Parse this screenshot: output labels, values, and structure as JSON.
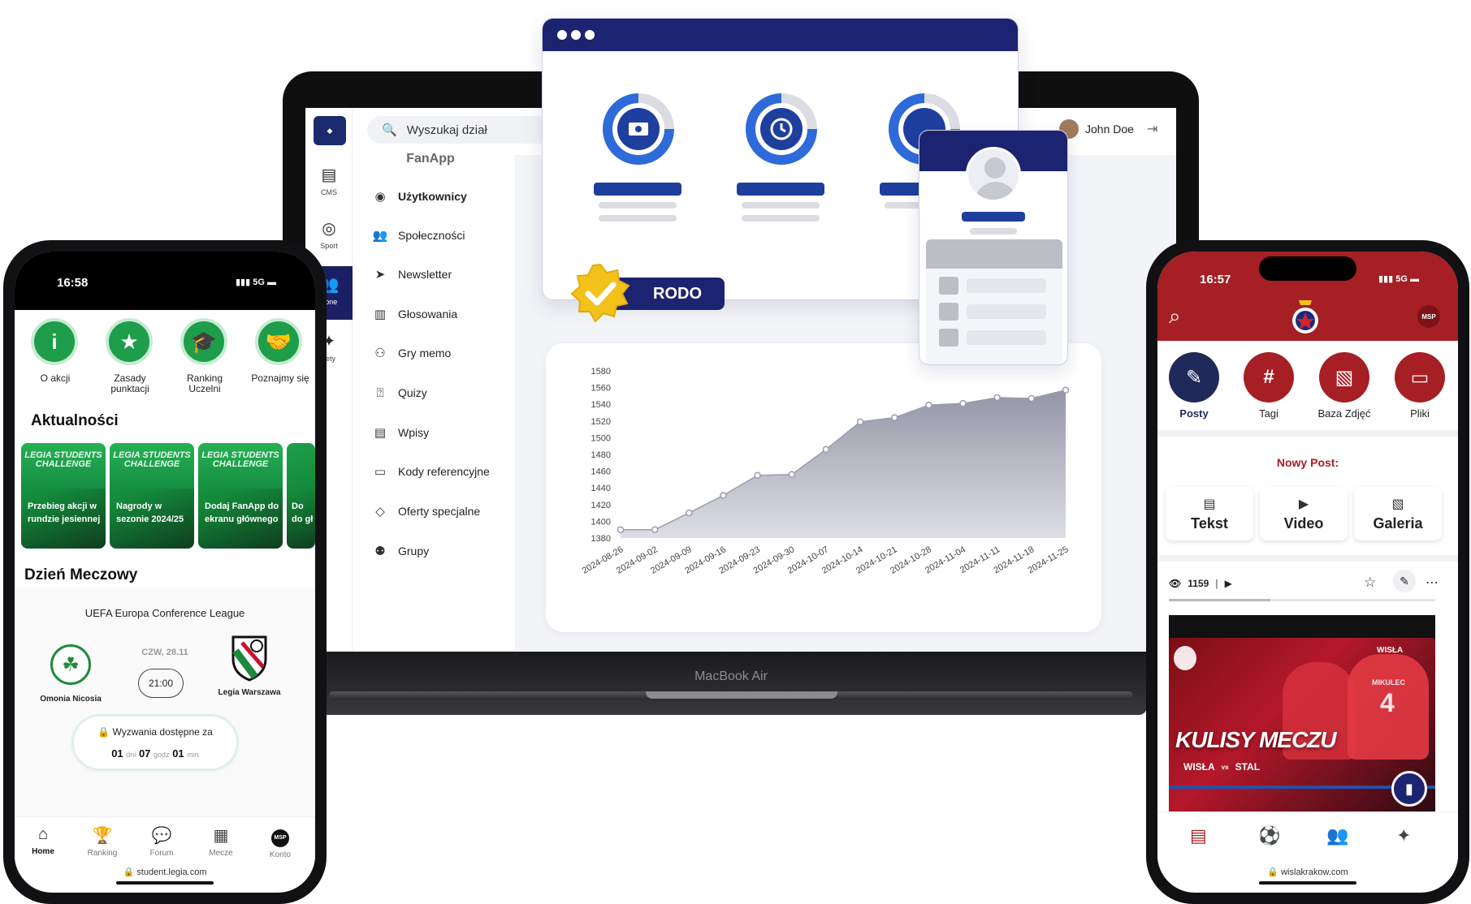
{
  "laptop": {
    "model_label": "MacBook Air",
    "search_placeholder": "Wyszukaj dział",
    "user_name": "John Doe",
    "rail": [
      {
        "label": "CMS",
        "icon": "document-icon"
      },
      {
        "label": "Sport",
        "icon": "basketball-icon"
      },
      {
        "label": "Zone",
        "icon": "users-icon"
      },
      {
        "label": "ilety",
        "icon": "ticket-icon"
      }
    ],
    "menu_title": "FanApp",
    "menu": [
      {
        "label": "Użytkownicy",
        "icon": "user-circle-icon",
        "active": true
      },
      {
        "label": "Społeczności",
        "icon": "group-icon"
      },
      {
        "label": "Newsletter",
        "icon": "send-icon"
      },
      {
        "label": "Głosowania",
        "icon": "poll-icon"
      },
      {
        "label": "Gry memo",
        "icon": "brain-icon"
      },
      {
        "label": "Quizy",
        "icon": "quiz-icon"
      },
      {
        "label": "Wpisy",
        "icon": "post-icon"
      },
      {
        "label": "Kody referencyjne",
        "icon": "code-icon"
      },
      {
        "label": "Oferty specjalne",
        "icon": "tag-icon"
      },
      {
        "label": "Grupy",
        "icon": "users-group-icon"
      }
    ]
  },
  "rodo_label": "RODO",
  "chart_data": {
    "type": "area",
    "x": [
      "2024-08-26",
      "2024-09-02",
      "2024-09-09",
      "2024-09-16",
      "2024-09-23",
      "2024-09-30",
      "2024-10-07",
      "2024-10-14",
      "2024-10-21",
      "2024-10-28",
      "2024-11-04",
      "2024-11-11",
      "2024-11-18",
      "2024-11-25"
    ],
    "values": [
      1390,
      1390,
      1410,
      1431,
      1455,
      1456,
      1486,
      1519,
      1524,
      1539,
      1541,
      1548,
      1547,
      1557
    ],
    "yticks": [
      1380,
      1400,
      1420,
      1440,
      1460,
      1480,
      1500,
      1520,
      1540,
      1560,
      1580
    ],
    "ylim": [
      1380,
      1580
    ],
    "grid": false,
    "colors": {
      "fill": "#8e8fa0",
      "line": "#9a9bb0"
    }
  },
  "legia": {
    "time": "16:58",
    "signal": "5G",
    "actions": [
      {
        "label": "O akcji",
        "icon": "info-icon"
      },
      {
        "label": "Zasady punktacji",
        "icon": "star-icon"
      },
      {
        "label": "Ranking Uczelni",
        "icon": "graduation-cap-icon"
      },
      {
        "label": "Poznajmy się",
        "icon": "handshake-icon"
      }
    ],
    "news_heading": "Aktualności",
    "news_card_brand": "LEGIA STUDENTS CHALLENGE",
    "news": [
      "Przebieg akcji w rundzie jesiennej",
      "Nagrody w sezonie 2024/25",
      "Dodaj FanApp do ekranu głównego",
      "Do do gł"
    ],
    "match_heading": "Dzień Meczowy",
    "league": "UEFA Europa Conference League",
    "home_team": "Omonia Nicosia",
    "away_team": "Legia Warszawa",
    "match_date": "CZW, 28.11",
    "match_time": "21:00",
    "countdown_label": "Wyzwania dostępne za",
    "countdown": {
      "d": "01",
      "d_unit": "dni",
      "h": "07",
      "h_unit": "godz",
      "m": "01",
      "m_unit": "min"
    },
    "nav": [
      {
        "label": "Home",
        "icon": "home-icon",
        "active": true
      },
      {
        "label": "Ranking",
        "icon": "trophy-icon"
      },
      {
        "label": "Forum",
        "icon": "chat-icon"
      },
      {
        "label": "Mecze",
        "icon": "calendar-icon"
      },
      {
        "label": "Konto",
        "icon": "account-icon",
        "badge": "MSP"
      }
    ],
    "url": "student.legia.com"
  },
  "wisla": {
    "time": "16:57",
    "signal": "5G",
    "avatar_badge": "MSP",
    "actions": [
      {
        "label": "Posty",
        "icon": "post-add-icon",
        "color": "#1f2a5a",
        "active": true
      },
      {
        "label": "Tagi",
        "icon": "hashtag-icon",
        "color": "#a51f24"
      },
      {
        "label": "Baza Zdjęć",
        "icon": "image-icon",
        "color": "#a51f24"
      },
      {
        "label": "Pliki",
        "icon": "folder-icon",
        "color": "#a51f24"
      }
    ],
    "new_post_label": "Nowy Post:",
    "post_types": [
      {
        "label": "Tekst",
        "icon": "text-icon"
      },
      {
        "label": "Video",
        "icon": "video-icon"
      },
      {
        "label": "Galeria",
        "icon": "gallery-icon"
      }
    ],
    "views": "1159",
    "video_title": "KULISY MECZU",
    "video_home": "WISŁA",
    "video_vs": "vs",
    "video_away": "STAL",
    "video_brand": "WISŁA",
    "player_name": "MIKULEC",
    "player_number": "4",
    "url": "wislakrakow.com"
  }
}
